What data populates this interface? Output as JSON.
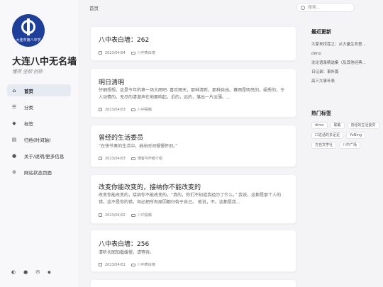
{
  "site": {
    "seal_text": "大连市第八中学",
    "title": "大连八中无名墙",
    "subtitle": "懂得 坚韧 创新"
  },
  "nav": [
    {
      "label": "首页",
      "icon": "home-icon"
    },
    {
      "label": "分类",
      "icon": "list-icon"
    },
    {
      "label": "标签",
      "icon": "tag-icon"
    },
    {
      "label": "归档(时间轴)",
      "icon": "archive-icon"
    },
    {
      "label": "关于/说明/更多信息",
      "icon": "info-icon"
    },
    {
      "label": "网站状态页面",
      "icon": "globe-icon"
    }
  ],
  "breadcrumb": "首页",
  "search": {
    "placeholder": "搜索..."
  },
  "posts": [
    {
      "title": "八中表白墙：262",
      "excerpt": "",
      "date": "2023/04/04",
      "category": "八中表白墙"
    },
    {
      "title": "明日清明",
      "excerpt": "仔细想想。这是今年的第一场大雨吧- 喜欢雨天，那种清新，那种自由。春雨是明亮的，娟秀的，令人动情的。无尽的清澈声在地面响起，近的，远的，落出一片淡薄。...",
      "date": "2023/04/03",
      "category": "八中投稿"
    },
    {
      "title": "曾经的生活委员",
      "excerpt": "“在快节奏的生活中，抽出时间慢慢怀旧。”",
      "date": "2023/04/03",
      "category": "博客与作者介绍"
    },
    {
      "title": "改变你能改变的，接纳你不能改变的",
      "excerpt": "改变你能改变的，接纳你不能改变的。“真的，你们不知道我经历了什么。” 我说，这都是那个人的错，这不是你的错，何必把所有原因都归咎于自己。 他说，不。这都是我...",
      "date": "2023/04/02",
      "category": "八中投稿"
    },
    {
      "title": "八中表白墙：256",
      "excerpt": "清听长图加载缓慢，请等待。",
      "date": "2023/04/01",
      "category": "八中表白墙"
    }
  ],
  "recent": {
    "heading": "最近更新",
    "items": [
      "大家来找茬之：从大量生命里...",
      "dimo",
      "沈论语录精选集（及其他经典...",
      "日记录：事外篇",
      "高三大事年表"
    ]
  },
  "hot_tags": {
    "heading": "热门标签",
    "items": [
      "dimo",
      "联載",
      "曾经的生活委员",
      "口这话的多足足",
      "YuNing",
      "方自文学社",
      "八中广场"
    ]
  }
}
